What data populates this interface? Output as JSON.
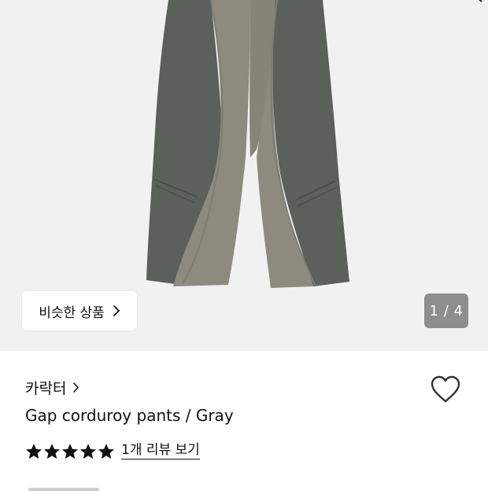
{
  "hero": {
    "similar_button_label": "비슷한 상품",
    "page_indicator": "1 / 4"
  },
  "product": {
    "brand": "카락터",
    "title": "Gap corduroy pants / Gray",
    "rating_stars": 5,
    "review_link": "1개 리뷰 보기"
  },
  "colors": {
    "hero_bg": "#f1f1f1",
    "pants_dark": "#5b605a",
    "pants_light": "#8d8b7f",
    "indicator_bg": "#8e8e8e"
  },
  "icons": {
    "share": "share-icon",
    "similar_chevron": "chevron-right-icon",
    "brand_chevron": "chevron-right-icon",
    "wishlist": "heart-outline-icon",
    "star": "star-filled-icon"
  }
}
